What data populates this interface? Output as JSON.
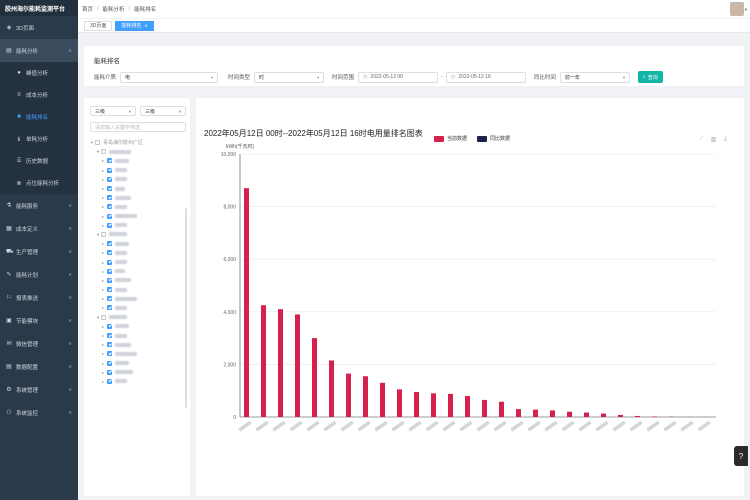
{
  "brand": "胶州海尔能耗监测平台",
  "sidebar": {
    "items": [
      {
        "label": "3D页面",
        "icon": "cube-icon",
        "has_children": false
      },
      {
        "label": "能耗分析",
        "icon": "chart-icon",
        "has_children": true,
        "expanded": true
      },
      {
        "label": "能耗服务",
        "icon": "service-icon",
        "has_children": true
      },
      {
        "label": "成本定义",
        "icon": "cost-icon",
        "has_children": true
      },
      {
        "label": "生产管理",
        "icon": "cart-icon",
        "has_children": true
      },
      {
        "label": "能耗计划",
        "icon": "plan-icon",
        "has_children": true
      },
      {
        "label": "报表推送",
        "icon": "report-icon",
        "has_children": true
      },
      {
        "label": "节能模块",
        "icon": "energy-icon",
        "has_children": true
      },
      {
        "label": "微信管理",
        "icon": "wechat-icon",
        "has_children": true
      },
      {
        "label": "数据配置",
        "icon": "data-icon",
        "has_children": true
      },
      {
        "label": "系统管理",
        "icon": "gear-icon",
        "has_children": true
      },
      {
        "label": "系统监控",
        "icon": "monitor-icon",
        "has_children": true
      }
    ],
    "sub_items": [
      {
        "label": "峰值分析",
        "icon": "peak-icon"
      },
      {
        "label": "成本分析",
        "icon": "list-icon"
      },
      {
        "label": "能耗排名",
        "icon": "rank-icon",
        "active": true
      },
      {
        "label": "单耗分析",
        "icon": "unit-icon"
      },
      {
        "label": "历史数据",
        "icon": "history-icon"
      },
      {
        "label": "点位能耗分析",
        "icon": "point-icon"
      }
    ]
  },
  "breadcrumb": [
    "首页",
    "能耗分析",
    "能耗排名"
  ],
  "tabs": [
    {
      "label": "3D页面",
      "active": false
    },
    {
      "label": "能耗排名",
      "active": true
    }
  ],
  "filter": {
    "title": "能耗排名",
    "energy_label": "能耗介质",
    "energy_value": "电",
    "time_type_label": "时间类型",
    "time_type_value": "时",
    "range_label": "时间范围",
    "range_start": "2022-05-12 00",
    "range_sep": "-",
    "range_end": "2022-05-12 16",
    "compare_label": "同比时间",
    "compare_value": "前一年",
    "query_button": "查询"
  },
  "tree": {
    "level_left": "三级",
    "level_right": "三级",
    "search_placeholder": "请您输入关键字筛选",
    "root_label": "青岛海尔胶州厂区",
    "nodes": [
      {
        "level": 1,
        "expanded": true,
        "checked": "half",
        "w": 22
      },
      {
        "level": 2,
        "checked": "full",
        "w": 14
      },
      {
        "level": 2,
        "checked": "full",
        "w": 12
      },
      {
        "level": 2,
        "checked": "full",
        "w": 12
      },
      {
        "level": 2,
        "checked": "full",
        "w": 10
      },
      {
        "level": 2,
        "checked": "full",
        "w": 16
      },
      {
        "level": 2,
        "checked": "full",
        "w": 12
      },
      {
        "level": 2,
        "checked": "full",
        "w": 22
      },
      {
        "level": 2,
        "checked": "full",
        "w": 12
      },
      {
        "level": 1,
        "expanded": true,
        "checked": "half",
        "w": 18
      },
      {
        "level": 2,
        "checked": "full",
        "w": 14
      },
      {
        "level": 2,
        "checked": "full",
        "w": 12
      },
      {
        "level": 2,
        "checked": "full",
        "w": 12
      },
      {
        "level": 2,
        "checked": "full",
        "w": 10
      },
      {
        "level": 2,
        "checked": "full",
        "w": 16
      },
      {
        "level": 2,
        "checked": "full",
        "w": 12
      },
      {
        "level": 2,
        "checked": "full",
        "w": 22
      },
      {
        "level": 2,
        "checked": "full",
        "w": 12
      },
      {
        "level": 1,
        "expanded": true,
        "checked": "half",
        "w": 18
      },
      {
        "level": 2,
        "checked": "full",
        "w": 14
      },
      {
        "level": 2,
        "checked": "full",
        "w": 12
      },
      {
        "level": 2,
        "checked": "full",
        "w": 16
      },
      {
        "level": 2,
        "checked": "full",
        "w": 22
      },
      {
        "level": 2,
        "checked": "full",
        "w": 14
      },
      {
        "level": 2,
        "checked": "full",
        "w": 18
      },
      {
        "level": 2,
        "checked": "full",
        "w": 12
      }
    ]
  },
  "chart_data": {
    "type": "bar",
    "title": "2022年05月12日 00时--2022年05月12日 16时电用量排名图表",
    "ylabel": "kWh(千瓦时)",
    "ylim": [
      0,
      10000
    ],
    "yticks": [
      "0",
      "2,000",
      "4,000",
      "6,000",
      "8,000",
      "10,000"
    ],
    "grid": true,
    "legend_position": "top",
    "series": [
      {
        "name": "当前数据",
        "color": "#d6204e",
        "values": [
          8700,
          4250,
          4100,
          3900,
          3000,
          2150,
          1650,
          1550,
          1300,
          1050,
          950,
          900,
          880,
          800,
          650,
          580,
          300,
          280,
          250,
          200,
          170,
          130,
          80,
          40,
          20,
          10,
          5,
          3
        ]
      },
      {
        "name": "同比数据",
        "color": "#1c2150",
        "values": [
          0,
          0,
          0,
          0,
          0,
          0,
          0,
          0,
          0,
          0,
          0,
          0,
          0,
          0,
          0,
          0,
          0,
          0,
          0,
          0,
          0,
          0,
          0,
          0,
          0,
          0,
          0,
          0
        ]
      }
    ],
    "category_count": 28
  },
  "toolbox": [
    "line-icon",
    "bar-icon",
    "download-icon"
  ],
  "help_label": "?"
}
